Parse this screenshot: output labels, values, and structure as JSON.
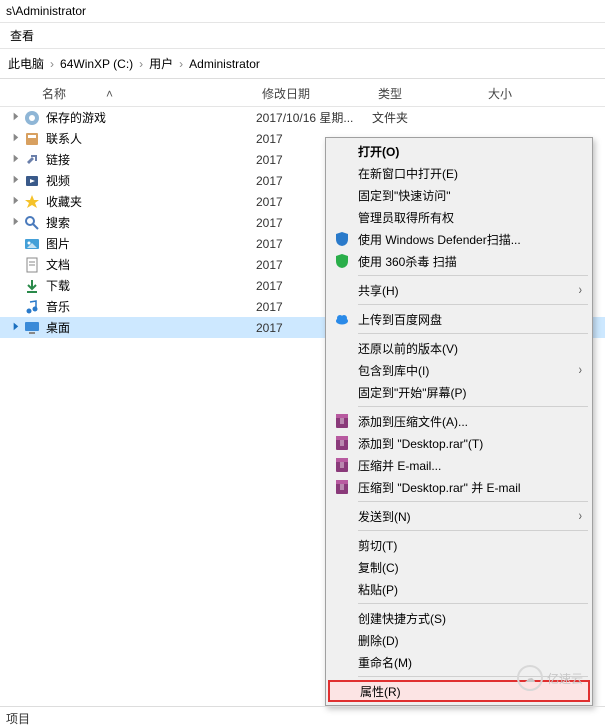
{
  "titlebar": "s\\Administrator",
  "menubar": {
    "view": "查看"
  },
  "crumbs": {
    "thispc": "此电脑",
    "drive": "64WinXP (C:)",
    "users": "用户",
    "admin": "Administrator"
  },
  "columns": {
    "name": "名称",
    "date": "修改日期",
    "type": "类型",
    "size": "大小"
  },
  "rows": [
    {
      "name": "保存的游戏",
      "date": "2017/10/16 星期...",
      "type": "文件夹"
    },
    {
      "name": "联系人",
      "date": "2017"
    },
    {
      "name": "链接",
      "date": "2017"
    },
    {
      "name": "视频",
      "date": "2017"
    },
    {
      "name": "收藏夹",
      "date": "2017"
    },
    {
      "name": "搜索",
      "date": "2017"
    },
    {
      "name": "图片",
      "date": "2017"
    },
    {
      "name": "文档",
      "date": "2017"
    },
    {
      "name": "下载",
      "date": "2017"
    },
    {
      "name": "音乐",
      "date": "2017"
    },
    {
      "name": "桌面",
      "date": "2017"
    }
  ],
  "menu": {
    "open": "打开(O)",
    "newwin": "在新窗口中打开(E)",
    "pin_quick": "固定到\"快速访问\"",
    "admin_own": "管理员取得所有权",
    "defender": "使用 Windows Defender扫描...",
    "scan360": "使用 360杀毒 扫描",
    "share": "共享(H)",
    "baidu": "上传到百度网盘",
    "restore": "还原以前的版本(V)",
    "library": "包含到库中(I)",
    "pin_start": "固定到\"开始\"屏幕(P)",
    "addarc": "添加到压缩文件(A)...",
    "adddesk": "添加到 \"Desktop.rar\"(T)",
    "emailarc": "压缩并 E-mail...",
    "emaildesk": "压缩到 \"Desktop.rar\" 并 E-mail",
    "sendto": "发送到(N)",
    "cut": "剪切(T)",
    "copy": "复制(C)",
    "paste": "粘贴(P)",
    "shortcut": "创建快捷方式(S)",
    "delete": "删除(D)",
    "rename": "重命名(M)",
    "props": "属性(R)"
  },
  "status": "项目",
  "watermark": "亿速云"
}
